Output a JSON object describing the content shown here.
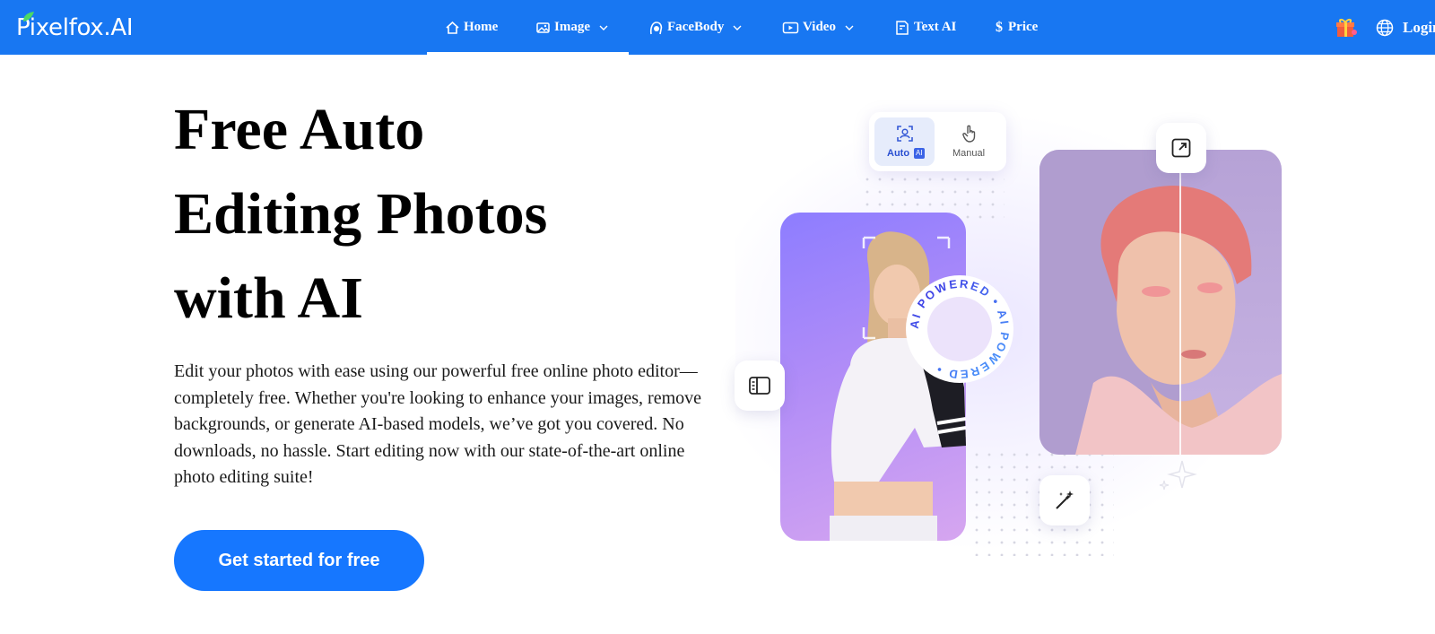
{
  "nav": {
    "logo": "Pixelfox.AI",
    "items": [
      {
        "label": "Home",
        "icon": "home-icon"
      },
      {
        "label": "Image",
        "icon": "image-icon"
      },
      {
        "label": "FaceBody",
        "icon": "face-icon"
      },
      {
        "label": "Video",
        "icon": "video-icon"
      },
      {
        "label": "Text AI",
        "icon": "text-ai-icon"
      },
      {
        "label": "Price",
        "icon": "dollar-icon"
      }
    ],
    "right": {
      "gift_icon": "gift-icon",
      "language_icon": "globe-icon",
      "login": "Login"
    }
  },
  "hero": {
    "title_lines": [
      "Free Auto",
      "Editing Photos",
      "with AI"
    ],
    "description": "Edit your photos with ease using our powerful free online photo editor—completely free. Whether you're looking to enhance your images, remove backgrounds, or generate AI-based models, we’ve got you covered. No downloads, no hassle. Start editing now with our state-of-the-art online photo editing suite!",
    "cta": "Get started for free"
  },
  "illustration": {
    "mode_toggle": {
      "auto": "Auto",
      "auto_badge": "AI",
      "manual": "Manual"
    },
    "badge_text": "AI POWERED • AI POWERED •"
  },
  "colors": {
    "brand": "#1877f2",
    "cta": "#1677ff"
  }
}
